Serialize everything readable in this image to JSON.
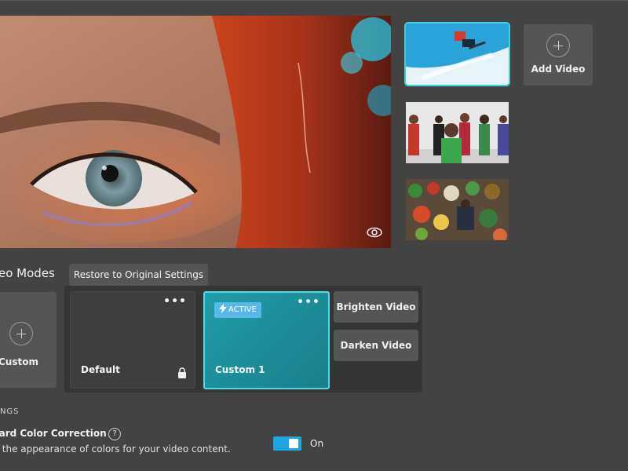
{
  "thumbnails": {
    "add_video_label": "Add Video"
  },
  "video_modes": {
    "title": "eo Modes",
    "restore_label": "Restore to Original Settings",
    "new_custom_label": "Custom",
    "cards": [
      {
        "name": "Default",
        "menu": "•••",
        "locked": true
      },
      {
        "name": "Custom 1",
        "menu": "•••",
        "badge": "ACTIVE"
      }
    ],
    "presets": [
      "Brighten Video",
      "Darken Video"
    ]
  },
  "settings": {
    "header": "INGS",
    "color_correction": {
      "title": "dard Color Correction",
      "help": "?",
      "description": "st the appearance of colors for your video content.",
      "state": "On",
      "enabled": true
    }
  },
  "colors": {
    "accent": "#1ba7e0",
    "active_card": "#1f9eaa",
    "background": "#434343"
  }
}
